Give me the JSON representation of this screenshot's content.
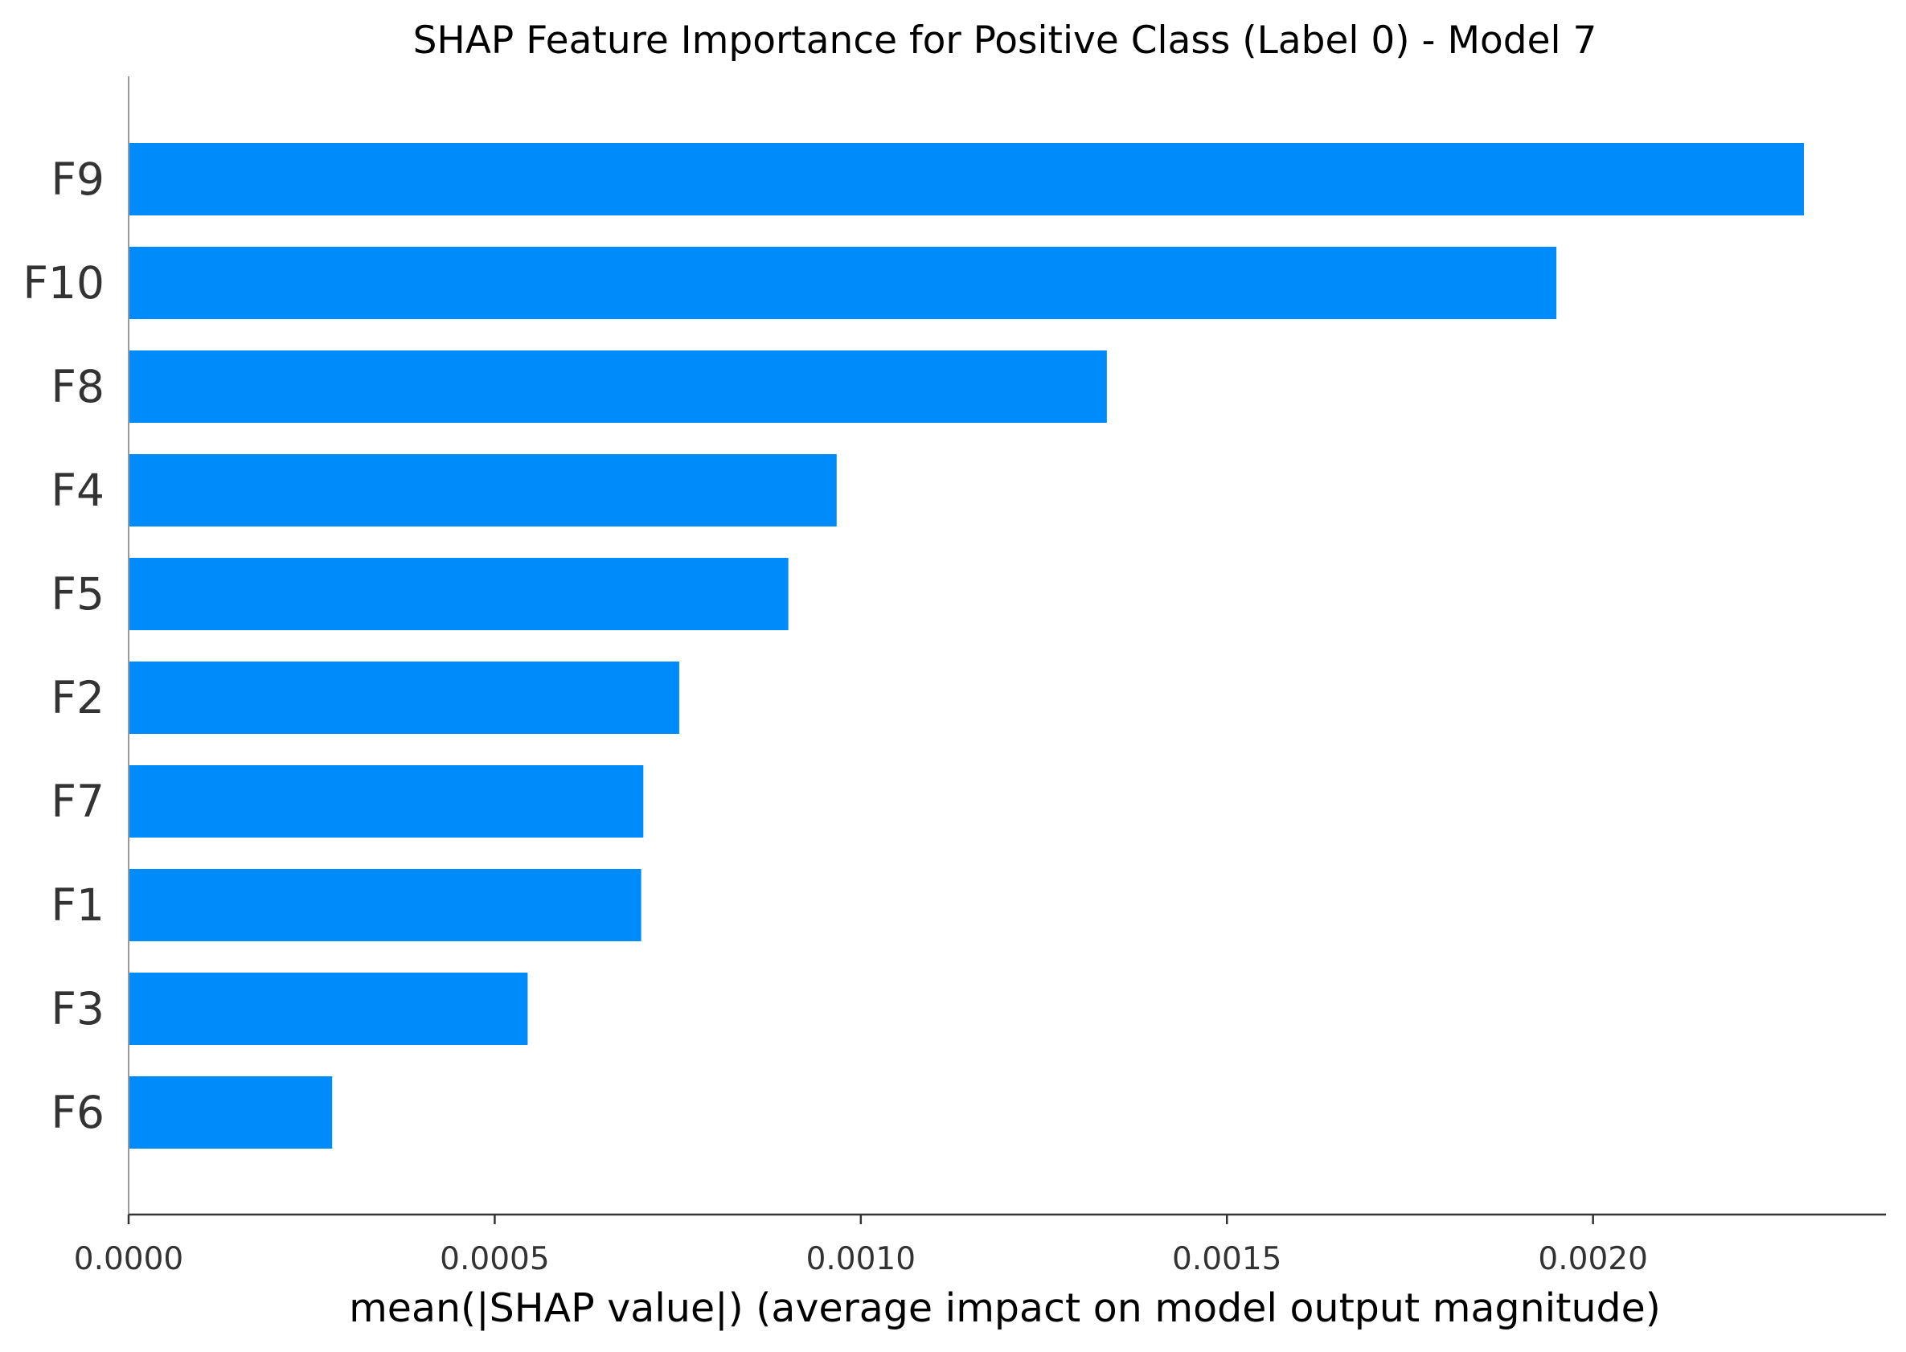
{
  "chart_data": {
    "type": "bar",
    "orientation": "horizontal",
    "title": "SHAP Feature Importance for Positive Class (Label 0) - Model 7",
    "xlabel": "mean(|SHAP value|) (average impact on model output magnitude)",
    "ylabel": "",
    "categories": [
      "F9",
      "F10",
      "F8",
      "F4",
      "F5",
      "F2",
      "F7",
      "F1",
      "F3",
      "F6"
    ],
    "values": [
      0.002288,
      0.00195,
      0.001336,
      0.000967,
      0.000901,
      0.000752,
      0.000703,
      0.0007,
      0.000545,
      0.000278
    ],
    "xlim": [
      0,
      0.0024
    ],
    "xticks": [
      0.0,
      0.0005,
      0.001,
      0.0015,
      0.002
    ],
    "xtick_labels": [
      "0.0000",
      "0.0005",
      "0.0010",
      "0.0015",
      "0.0020"
    ],
    "grid": false,
    "bar_color": "#008bfb",
    "axis_color": "#333333"
  }
}
